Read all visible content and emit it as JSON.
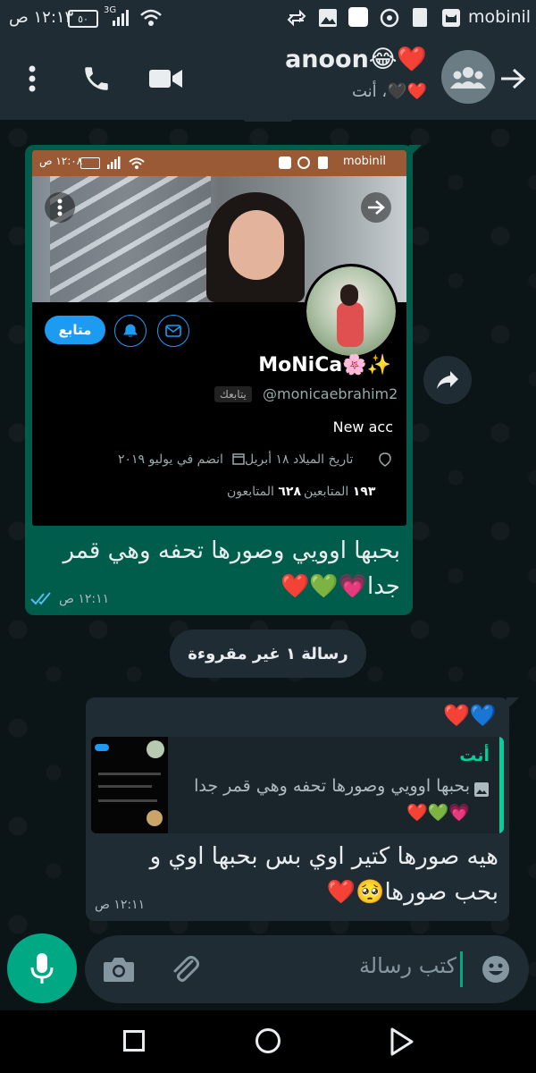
{
  "status_bar": {
    "time": "١٢:١٣ ص",
    "battery": "٥٠",
    "network": "3G",
    "carrier": "mobinil"
  },
  "header": {
    "title": "anoon😂❤️",
    "subtitle": "❤️🖤، أنت"
  },
  "messages": {
    "m1": {
      "text": "بحبها اوويي وصورها تحفه وهي قمر جدا💗💚❤️",
      "time": "١٢:١١ ص"
    },
    "unread_label": "رسالة ١ غير مقروءة",
    "m2": {
      "reactions": "❤️💙",
      "reply_author": "أنت",
      "reply_text": "بحبها اوويي وصورها تحفه وهي قمر جدا💗💚❤️",
      "text": "هيه صورها كتير اوي بس بحبها اوي و بحب صورها🥺❤️",
      "time": "١٢:١١ ص"
    }
  },
  "profile_screenshot": {
    "status_time": "١٢:٠٨ ص",
    "carrier": "mobinil",
    "follow_button": "متابع",
    "display_name": "MoNiCa🌸✨",
    "follows_you": "يتابعك",
    "handle": "@monicaebrahim2",
    "bio": "New acc",
    "birthday": "تاريخ الميلاد ١٨ أبريل",
    "joined": "انضم في يوليو ٢٠١٩",
    "following_count": "١٩٣",
    "following_label": "المتابعين",
    "followers_count": "٦٢٨",
    "followers_label": "المتابعون"
  },
  "composer": {
    "placeholder": "كتب رسالة"
  },
  "colors": {
    "outgoing_bubble": "#005c4b",
    "incoming_bubble": "#1f2c33",
    "accent": "#00a884",
    "header_bg": "#1f2c33"
  }
}
